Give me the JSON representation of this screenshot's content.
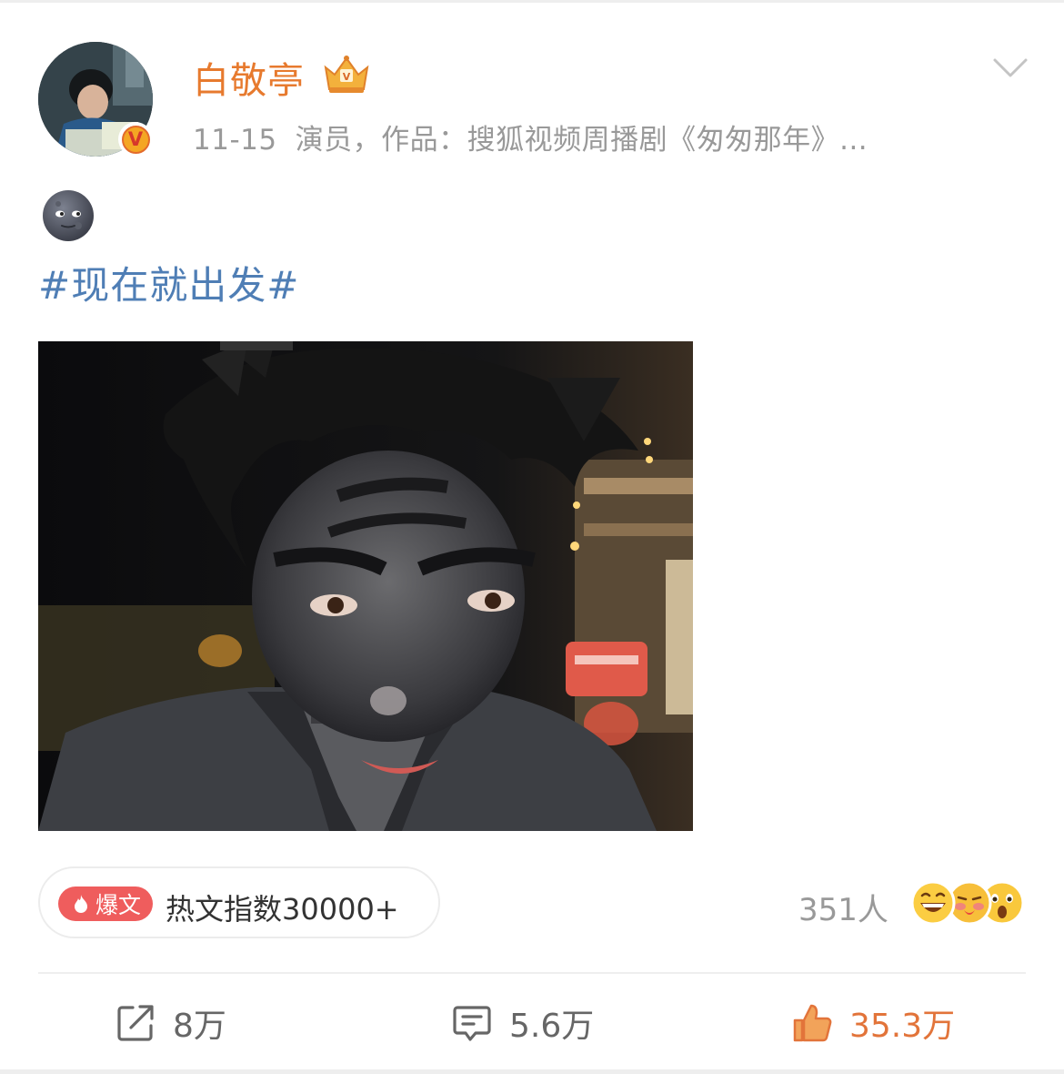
{
  "post": {
    "author": {
      "name": "白敬亭",
      "avatar": "avatar-photo",
      "verified_badge": "V",
      "crown": "crown-icon"
    },
    "time": "11-15",
    "source": "演员，作品：搜狐视频周播剧《匆匆那年》...",
    "emoji": "new-moon-face-emoji",
    "topic": "#现在就出发#",
    "image": "selfie-photo-face-painted-black"
  },
  "hot": {
    "tag_label": "爆文",
    "text": "热文指数30000+"
  },
  "reactions": {
    "count": "351人",
    "icons": [
      "laughing-emoji",
      "kiss-emoji",
      "surprised-emoji"
    ]
  },
  "actions": {
    "repost_count": "8万",
    "comment_count": "5.6万",
    "like_count": "35.3万"
  },
  "colors": {
    "username": "#e77a2e",
    "topic": "#4f7eb5",
    "hot_tag": "#ef5d5d",
    "like": "#e2743a",
    "meta": "#999999"
  }
}
